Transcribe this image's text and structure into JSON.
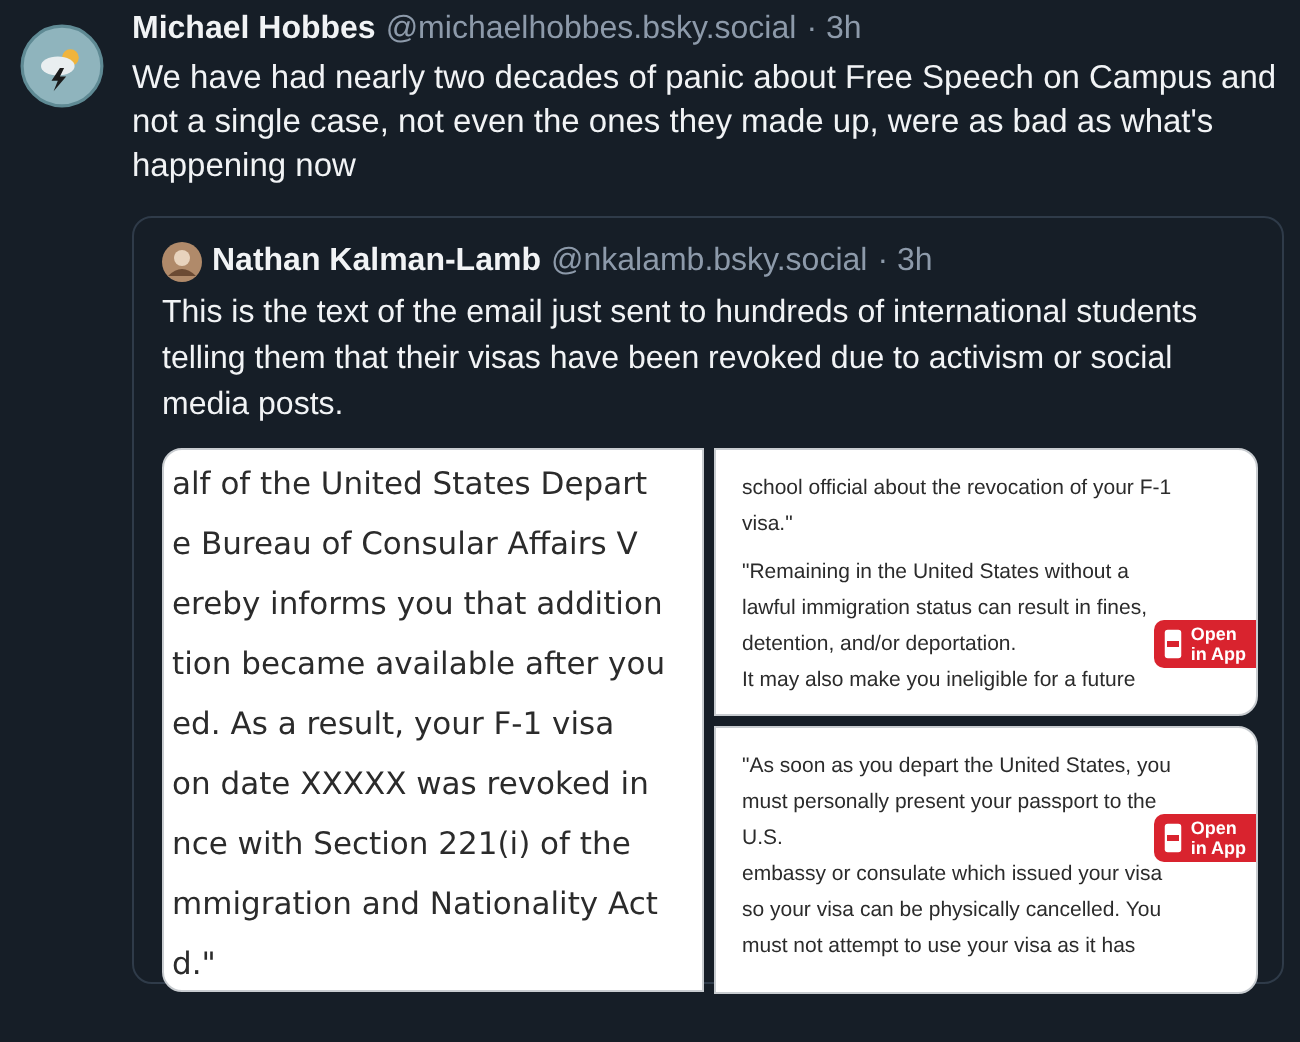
{
  "post": {
    "author": "Michael Hobbes",
    "handle": "@michaelhobbes.bsky.social",
    "time": "· 3h",
    "text": "We have had nearly two decades of panic about Free Speech on Campus and not a single case, not even the ones they made up, were as bad as what's happening now"
  },
  "quote": {
    "author": "Nathan Kalman-Lamb",
    "handle": "@nkalamb.bsky.social",
    "time": "· 3h",
    "text": "This is the text of the email just sent to hundreds of international students telling them that their visas have been revoked due to activism or social media posts.",
    "images": [
      {
        "kind": "large",
        "paragraphs": [
          [
            {
              "text": "alf of the United States Depart"
            },
            {
              "text": "e Bureau of Consular Affairs V"
            },
            {
              "text": "ereby informs you that addition"
            },
            {
              "text": "tion became available after you"
            },
            {
              "text": "ed. As a result, your F-1 visa"
            },
            {
              "text": "on date XXXXX was revoked in"
            },
            {
              "text": "nce with Section 221(i) of the"
            },
            {
              "text": "mmigration and Nationality Act"
            },
            {
              "text": "d.\""
            }
          ]
        ]
      },
      {
        "kind": "small",
        "paragraphs": [
          [
            {
              "text": "school official about the revocation of your F-1"
            },
            {
              "text": "visa.\""
            }
          ],
          [
            {
              "text": "\"Remaining in the United States without a"
            },
            {
              "text": "lawful immigration status can result in fines,"
            },
            {
              "text": "detention, and/or deportation.",
              "badge": [
                "Open",
                "in App"
              ]
            },
            {
              "text": "It may also make you ineligible for a future"
            }
          ]
        ]
      },
      {
        "kind": "small",
        "paragraphs": [
          [
            {
              "text": "\"As soon as you depart the United States, you"
            },
            {
              "text": "must personally present your passport to the"
            },
            {
              "text": "U.S.",
              "badge": [
                "Open",
                "in App"
              ]
            },
            {
              "text": "embassy or consulate which issued your visa"
            },
            {
              "text": "so your visa can be physically cancelled. You"
            },
            {
              "text": "must not attempt to use your visa as it has"
            }
          ]
        ]
      }
    ]
  }
}
